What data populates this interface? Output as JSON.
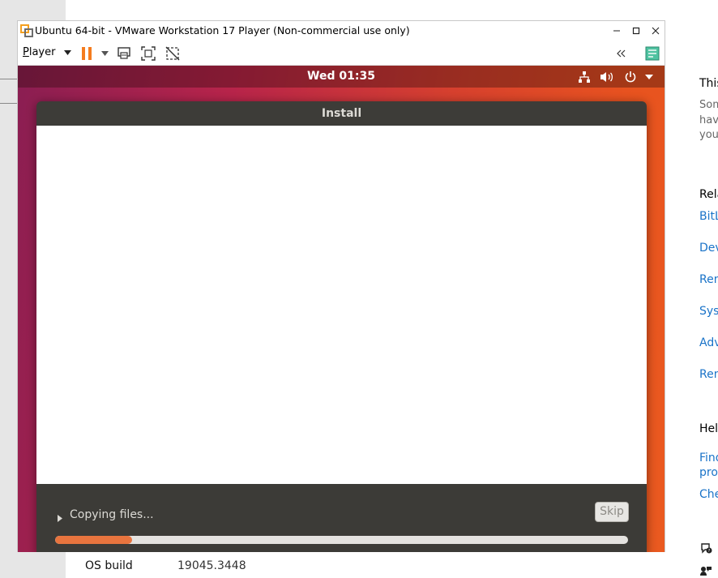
{
  "vmware": {
    "title": "Ubuntu 64-bit - VMware Workstation 17 Player (Non-commercial use only)",
    "player_first": "P",
    "player_rest": "layer",
    "icons": [
      "minimize-icon",
      "maximize-icon",
      "close-icon",
      "pause-icon",
      "dropdown-icon",
      "send-ctrl-alt-del-icon",
      "fit-guest-icon",
      "unity-icon",
      "collapse-icon",
      "library-icon"
    ],
    "accent_color": "#f57c1f"
  },
  "ubuntu": {
    "clock": "Wed 01:35",
    "tray_icons": [
      "network-icon",
      "volume-icon",
      "power-icon",
      "chevron-down-icon"
    ],
    "installer": {
      "title": "Install",
      "status": "Copying files...",
      "skip_label": "Skip",
      "progress": 0.135,
      "progress_color": "#e8743e"
    }
  },
  "settings_bg": {
    "os_build_label": "OS build",
    "os_build_value": "19045.3448",
    "right_column": {
      "heading1": "This",
      "gray_lines": [
        "Som",
        "have",
        "you"
      ],
      "heading2": "Rela",
      "links": [
        "BitL",
        "Dev",
        "Rem",
        "Syst",
        "Adv",
        "Ren"
      ],
      "heading3": "Help",
      "help_links": [
        "Find",
        "proc",
        "Che"
      ]
    }
  }
}
